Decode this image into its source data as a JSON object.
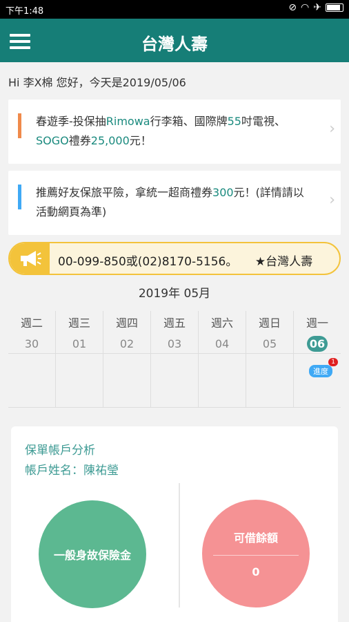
{
  "status": {
    "time": "下午1:48"
  },
  "header": {
    "title": "台灣人壽"
  },
  "greeting": "Hi 李X棉 您好，今天是2019/05/06",
  "promos": [
    {
      "pre": "春遊季-投保抽",
      "hl": "Rimowa",
      "mid": "行李箱、國際牌",
      "hl2": "55",
      "post": "吋電視、",
      "hl3": "SOGO",
      "post2": "禮券",
      "hl4": "25,000",
      "post3": "元！",
      "bar_color": "#f08a4b"
    },
    {
      "pre": "推薦好友保旅平險，拿統一超商禮券",
      "hl": "300",
      "post": "元！(詳情請以活動網頁為準)",
      "bar_color": "#3fa9f5"
    }
  ],
  "ticker": {
    "text": "00-099-850或(02)8170-5156。　　★台灣人壽"
  },
  "calendar": {
    "month_label": "2019年 05月",
    "days": [
      {
        "weekday": "週二",
        "date": "30"
      },
      {
        "weekday": "週三",
        "date": "01"
      },
      {
        "weekday": "週四",
        "date": "02"
      },
      {
        "weekday": "週五",
        "date": "03"
      },
      {
        "weekday": "週六",
        "date": "04"
      },
      {
        "weekday": "週日",
        "date": "05"
      },
      {
        "weekday": "週一",
        "date": "06"
      }
    ],
    "badge_label": "進度",
    "badge_count": "1"
  },
  "analysis": {
    "title": "保單帳戶分析",
    "account_name": "帳戶姓名：陳祐瑩",
    "left_label": "一般身故保險金",
    "right_label": "可借餘額",
    "right_value": "0"
  }
}
